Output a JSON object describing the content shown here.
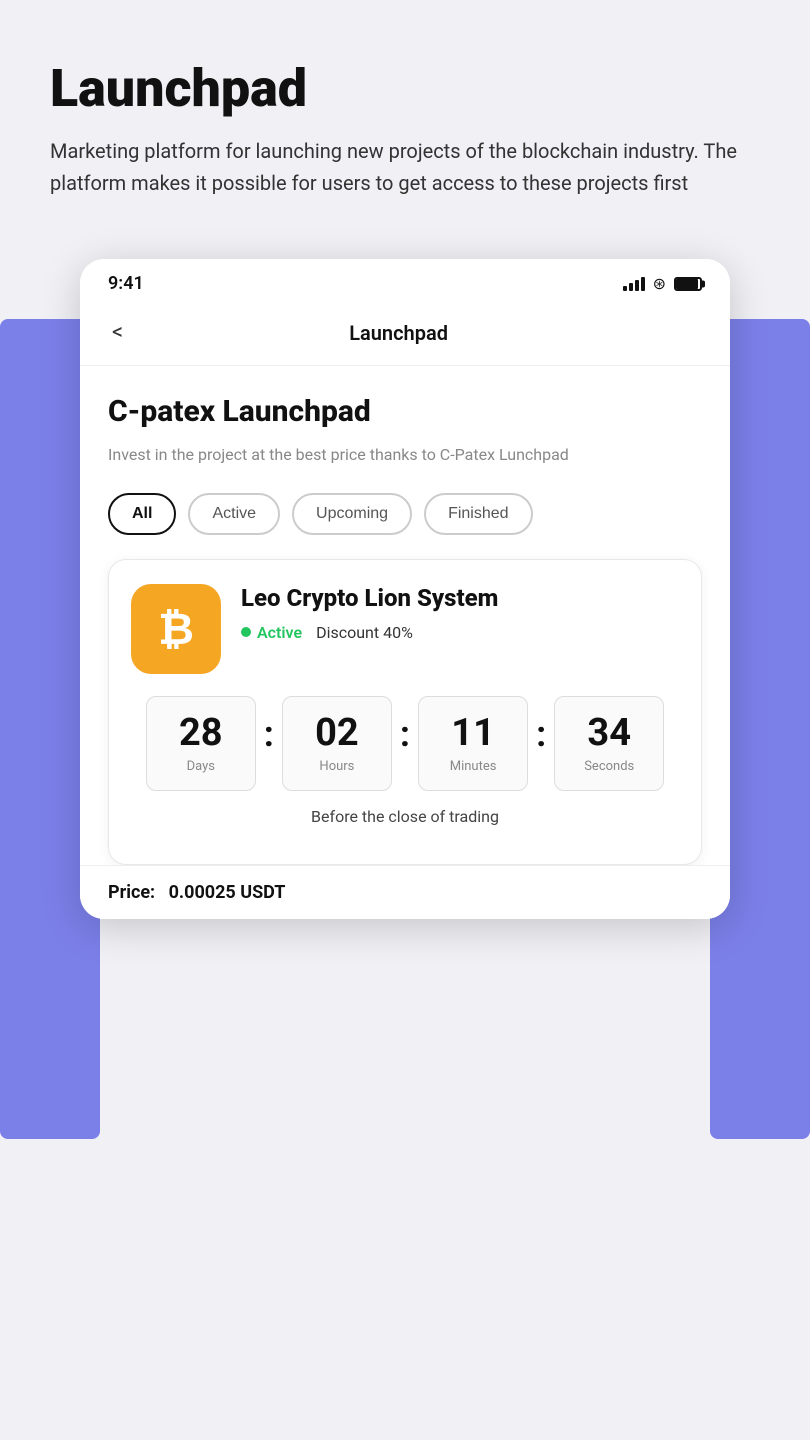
{
  "description": {
    "title": "Launchpad",
    "text": "Marketing platform for launching new projects of the blockchain industry. The platform makes it possible for users to get access to these projects first"
  },
  "status_bar": {
    "time": "9:41"
  },
  "nav": {
    "back_label": "<",
    "title": "Launchpad"
  },
  "main": {
    "heading": "C-patex Launchpad",
    "description": "Invest in the project at the best price thanks to C-Patex Lunchpad",
    "filters": [
      {
        "label": "All",
        "active": true
      },
      {
        "label": "Active",
        "active": false
      },
      {
        "label": "Upcoming",
        "active": false
      },
      {
        "label": "Finished",
        "active": false
      }
    ]
  },
  "project_card": {
    "name": "Leo Crypto Lion System",
    "status": "Active",
    "discount": "Discount 40%",
    "countdown": {
      "days": {
        "value": "28",
        "label": "Days"
      },
      "hours": {
        "value": "02",
        "label": "Hours"
      },
      "minutes": {
        "value": "11",
        "label": "Minutes"
      },
      "seconds": {
        "value": "34",
        "label": "Seconds"
      },
      "caption": "Before the close of trading"
    },
    "price_label": "Price:",
    "price_value": "0.00025 USDT"
  }
}
